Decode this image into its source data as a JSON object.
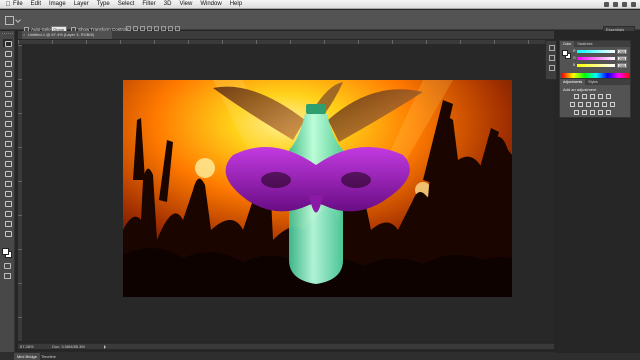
{
  "menubar": {
    "apple": "",
    "items": [
      "File",
      "Edit",
      "Image",
      "Layer",
      "Type",
      "Select",
      "Filter",
      "3D",
      "View",
      "Window",
      "Help"
    ]
  },
  "options_bar": {
    "auto_select_label": "Auto-Select:",
    "auto_select_value": "Group",
    "show_transform_label": "Show Transform Controls",
    "workspace": "Essentials"
  },
  "document": {
    "tab_title": "Untitled-1 @ 67.4% (Layer 3, RGB/8)",
    "zoom": "67.38%",
    "doc_size": "Doc: 3.56M/85.3M"
  },
  "bottom_tabs": [
    {
      "label": "Mini Bridge",
      "active": true
    },
    {
      "label": "Timeline",
      "active": false
    }
  ],
  "color_panel": {
    "tabs": [
      "Color",
      "Swatches"
    ],
    "channels": [
      {
        "name": "R",
        "value": "255"
      },
      {
        "name": "G",
        "value": "255"
      },
      {
        "name": "B",
        "value": "255"
      }
    ],
    "foreground": "#ffffff",
    "background": "#ffffff"
  },
  "adjustments_panel": {
    "tabs": [
      "Adjustments",
      "Styles"
    ],
    "add_label": "Add an adjustment"
  },
  "canvas": {
    "scene_colors": {
      "glow": "#ffd21a",
      "orange": "#ff7a00",
      "deep": "#4a1200",
      "mask": "#9a1fb5",
      "bottle": "#8ff0c4",
      "feather": "#a06030"
    }
  }
}
